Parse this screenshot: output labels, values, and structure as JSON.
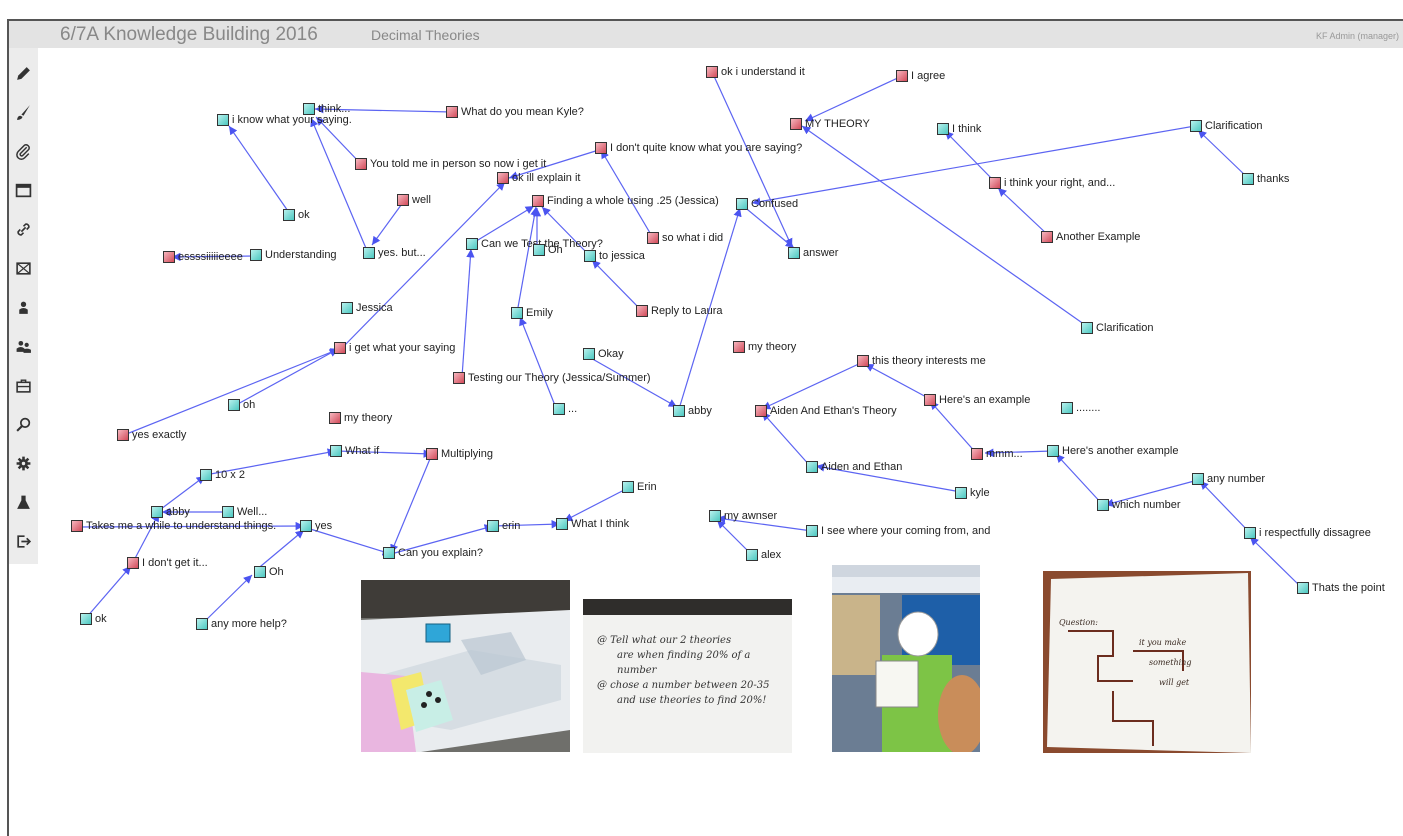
{
  "header": {
    "app_title": "6/7A Knowledge Building 2016",
    "view_title": "Decimal Theories",
    "user": "KF Admin (manager)"
  },
  "toolbar": [
    {
      "icon": "pencil-icon"
    },
    {
      "icon": "brush-icon"
    },
    {
      "icon": "paperclip-icon"
    },
    {
      "icon": "window-icon"
    },
    {
      "icon": "link-icon"
    },
    {
      "icon": "crop-icon"
    },
    {
      "icon": "user-icon"
    },
    {
      "icon": "users-icon"
    },
    {
      "icon": "briefcase-icon"
    },
    {
      "icon": "search-icon"
    },
    {
      "icon": "gear-icon"
    },
    {
      "icon": "flask-icon"
    },
    {
      "icon": "logout-icon"
    }
  ],
  "notes": [
    {
      "id": "n1",
      "label": "ok i understand it",
      "type": "r"
    },
    {
      "id": "n2",
      "label": "I agree",
      "type": "r"
    },
    {
      "id": "n3",
      "label": "MY THEORY",
      "type": "r"
    },
    {
      "id": "n4",
      "label": "i know what your saying.",
      "type": "c"
    },
    {
      "id": "n5",
      "label": "think...",
      "type": "c"
    },
    {
      "id": "n6",
      "label": "What do you mean Kyle?",
      "type": "r"
    },
    {
      "id": "n7",
      "label": "I think",
      "type": "c"
    },
    {
      "id": "n8",
      "label": "Clarification",
      "type": "c"
    },
    {
      "id": "n9",
      "label": "I don't quite know what you are saying?",
      "type": "r"
    },
    {
      "id": "n10",
      "label": "You told me in person so now i get it",
      "type": "r"
    },
    {
      "id": "n11",
      "label": "ok ill explain it",
      "type": "r"
    },
    {
      "id": "n12",
      "label": "thanks",
      "type": "c"
    },
    {
      "id": "n13",
      "label": "i think your right, and...",
      "type": "r"
    },
    {
      "id": "n14",
      "label": "Finding a whole using .25 (Jessica)",
      "type": "r"
    },
    {
      "id": "n15",
      "label": "Confused",
      "type": "c"
    },
    {
      "id": "n16",
      "label": "well",
      "type": "r"
    },
    {
      "id": "n17",
      "label": "ok",
      "type": "c"
    },
    {
      "id": "n18",
      "label": "so what i did",
      "type": "r"
    },
    {
      "id": "n19",
      "label": "Another Example",
      "type": "r"
    },
    {
      "id": "n20",
      "label": "Can we Test the Theory?",
      "type": "c"
    },
    {
      "id": "n21",
      "label": "Oh",
      "type": "c"
    },
    {
      "id": "n22",
      "label": "yes. but...",
      "type": "c"
    },
    {
      "id": "n23",
      "label": "to jessica",
      "type": "c"
    },
    {
      "id": "n24",
      "label": "answer",
      "type": "c"
    },
    {
      "id": "n25",
      "label": "Understanding",
      "type": "c"
    },
    {
      "id": "n26",
      "label": "essssiiiiieeee",
      "type": "r"
    },
    {
      "id": "n27",
      "label": "Jessica",
      "type": "c"
    },
    {
      "id": "n28",
      "label": "Emily",
      "type": "c"
    },
    {
      "id": "n29",
      "label": "Reply to Laura",
      "type": "r"
    },
    {
      "id": "n30",
      "label": "Clarification",
      "type": "c"
    },
    {
      "id": "n31",
      "label": "i get what your saying",
      "type": "r"
    },
    {
      "id": "n32",
      "label": "my theory",
      "type": "r"
    },
    {
      "id": "n33",
      "label": "Okay",
      "type": "c"
    },
    {
      "id": "n34",
      "label": "this theory interests me",
      "type": "r"
    },
    {
      "id": "n35",
      "label": "Testing our Theory (Jessica/Summer)",
      "type": "r"
    },
    {
      "id": "n36",
      "label": "Here's an example",
      "type": "r"
    },
    {
      "id": "n37",
      "label": "oh",
      "type": "c"
    },
    {
      "id": "n38",
      "label": "...",
      "type": "c"
    },
    {
      "id": "n39",
      "label": "abby",
      "type": "c"
    },
    {
      "id": "n40",
      "label": "Aiden And Ethan's Theory",
      "type": "r"
    },
    {
      "id": "n41",
      "label": "........",
      "type": "c"
    },
    {
      "id": "n42",
      "label": "my theory",
      "type": "r"
    },
    {
      "id": "n43",
      "label": "yes exactly",
      "type": "r"
    },
    {
      "id": "n44",
      "label": "What if",
      "type": "c"
    },
    {
      "id": "n45",
      "label": "Multiplying",
      "type": "r"
    },
    {
      "id": "n46",
      "label": "mmm...",
      "type": "r"
    },
    {
      "id": "n47",
      "label": "Here's another example",
      "type": "c"
    },
    {
      "id": "n48",
      "label": "Aiden and Ethan",
      "type": "c"
    },
    {
      "id": "n49",
      "label": "10 x 2",
      "type": "c"
    },
    {
      "id": "n50",
      "label": "any number",
      "type": "c"
    },
    {
      "id": "n51",
      "label": "Erin",
      "type": "c"
    },
    {
      "id": "n52",
      "label": "kyle",
      "type": "c"
    },
    {
      "id": "n53",
      "label": "abby",
      "type": "c"
    },
    {
      "id": "n54",
      "label": "Well...",
      "type": "c"
    },
    {
      "id": "n55",
      "label": "which number",
      "type": "c"
    },
    {
      "id": "n56",
      "label": "my awnser",
      "type": "c"
    },
    {
      "id": "n57",
      "label": "Takes me a while to understand things.",
      "type": "r"
    },
    {
      "id": "n58",
      "label": "yes",
      "type": "c"
    },
    {
      "id": "n59",
      "label": "erin",
      "type": "c"
    },
    {
      "id": "n60",
      "label": "What I think",
      "type": "c"
    },
    {
      "id": "n61",
      "label": "I see where your coming from, and",
      "type": "c"
    },
    {
      "id": "n62",
      "label": "i respectfully dissagree",
      "type": "c"
    },
    {
      "id": "n63",
      "label": "Can you explain?",
      "type": "c"
    },
    {
      "id": "n64",
      "label": "alex",
      "type": "c"
    },
    {
      "id": "n65",
      "label": "I don't get it...",
      "type": "r"
    },
    {
      "id": "n66",
      "label": "Oh",
      "type": "c"
    },
    {
      "id": "n67",
      "label": "Thats the point",
      "type": "c"
    },
    {
      "id": "n68",
      "label": "ok",
      "type": "c"
    },
    {
      "id": "n69",
      "label": "any more help?",
      "type": "c"
    }
  ],
  "photos": [
    {
      "id": "photo1",
      "icon": "classroom-table-photo"
    },
    {
      "id": "photo2",
      "icon": "whiteboard-photo",
      "lines": [
        "@ Tell what our 2 theories",
        "are when finding 20% of a",
        "number",
        "@ chose a number between 20-35",
        "and use theories to find 20%!"
      ]
    },
    {
      "id": "photo3",
      "icon": "student-poster-photo"
    },
    {
      "id": "photo4",
      "icon": "worksheet-photo",
      "lines": [
        "Question:",
        "it you make",
        "something",
        "will get"
      ]
    }
  ]
}
